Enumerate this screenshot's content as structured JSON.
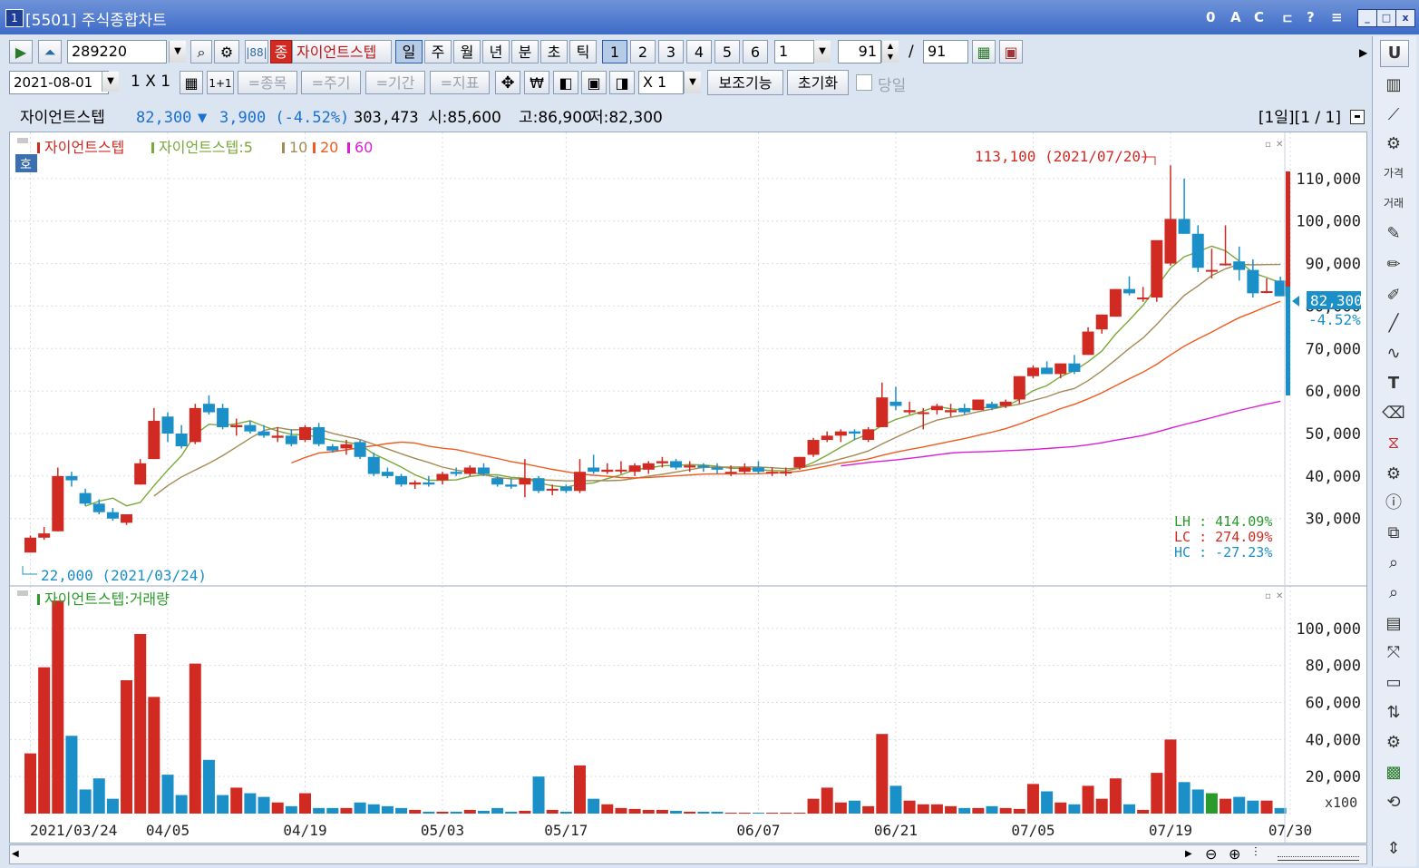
{
  "window": {
    "app_number": "1",
    "title": "[5501] 주식종합차트",
    "title_icons": [
      "0",
      "A",
      "C",
      "ㄷ",
      "?",
      "≡"
    ],
    "controls": [
      "_",
      "□",
      "x"
    ]
  },
  "toolbar1": {
    "code": "289220",
    "badge": "종",
    "stock_name": "자이언트스텝",
    "periods": [
      "일",
      "주",
      "월",
      "년",
      "분",
      "초",
      "틱"
    ],
    "numbers": [
      "1",
      "2",
      "3",
      "4",
      "5",
      "6"
    ],
    "count_value": "1",
    "range_value": "91",
    "range_sep": "/",
    "range_total": "91"
  },
  "toolbar2": {
    "date": "2021-08-01",
    "layout": "1 X 1",
    "layout_btn": "1+1",
    "tabs": [
      "=종목",
      "=주기",
      "=기간",
      "=지표"
    ],
    "multiplier": "X 1",
    "aux_button": "보조기능",
    "reset_button": "초기화",
    "today_label": "당일"
  },
  "info": {
    "name": "자이언트스텝",
    "price": "82,300",
    "arrow": "▼",
    "change": "3,900 (-4.52%)",
    "volume": "303,473",
    "open": "시:85,600",
    "high": "고:86,900",
    "low": "저:82,300",
    "period": "[1일][1 / 1]"
  },
  "price_panel": {
    "legend_name": "자이언트스텝",
    "legend_ma_label": "자이언트스텝:5",
    "legend_ma": [
      "10",
      "20",
      "60"
    ],
    "ho_badge": "호",
    "high_note": "113,100 (2021/07/20)",
    "low_note": "22,000 (2021/03/24)",
    "current_price": "82,300",
    "current_pct": "-4.52%",
    "stats": [
      "LH : 414.09%",
      "LC : 274.09%",
      "HC : -27.23%"
    ],
    "y_labels": [
      "110,000",
      "100,000",
      "90,000",
      "80,000",
      "70,000",
      "60,000",
      "50,000",
      "40,000",
      "30,000"
    ]
  },
  "volume_panel": {
    "legend": "자이언트스텝:거래량",
    "y_labels": [
      "100,000",
      "80,000",
      "60,000",
      "40,000",
      "20,000"
    ],
    "unit": "x100"
  },
  "x_labels": [
    "2021/03/24",
    "04/05",
    "04/19",
    "05/03",
    "05/17",
    "06/07",
    "06/21",
    "07/05",
    "07/19",
    "07/30"
  ],
  "colors": {
    "up": "#d12a22",
    "down": "#1a8fc8",
    "ma5": "#7aa83a",
    "ma10": "#a48a55",
    "ma20": "#f05a1e",
    "ma60": "#d91ed6"
  },
  "chart_data": {
    "type": "candlestick",
    "ohlc": [
      [
        22000,
        26000,
        22000,
        25500
      ],
      [
        25500,
        28000,
        25000,
        26500
      ],
      [
        27000,
        42000,
        27000,
        40000
      ],
      [
        40000,
        41000,
        37500,
        39000
      ],
      [
        36000,
        37000,
        33000,
        33500
      ],
      [
        33500,
        34500,
        31000,
        31500
      ],
      [
        31500,
        32500,
        29500,
        30000
      ],
      [
        29000,
        31000,
        28500,
        31000
      ],
      [
        38000,
        44000,
        38000,
        43000
      ],
      [
        44000,
        56000,
        44000,
        53000
      ],
      [
        54000,
        55000,
        48000,
        50000
      ],
      [
        50000,
        52000,
        46500,
        47000
      ],
      [
        48000,
        57000,
        47500,
        56000
      ],
      [
        57000,
        59000,
        54500,
        55000
      ],
      [
        56000,
        57000,
        51000,
        51500
      ],
      [
        51500,
        53500,
        49500,
        52000
      ],
      [
        52000,
        53000,
        50000,
        50500
      ],
      [
        50500,
        52000,
        49000,
        49500
      ],
      [
        49000,
        51500,
        48000,
        49500
      ],
      [
        49500,
        51000,
        47000,
        47500
      ],
      [
        48500,
        52000,
        48000,
        51500
      ],
      [
        51500,
        52500,
        47000,
        47500
      ],
      [
        47000,
        47500,
        45500,
        46000
      ],
      [
        46500,
        48500,
        45000,
        47500
      ],
      [
        48000,
        48500,
        44000,
        44500
      ],
      [
        44500,
        45500,
        40000,
        40500
      ],
      [
        41000,
        42000,
        39500,
        40000
      ],
      [
        40000,
        40500,
        37500,
        38000
      ],
      [
        38000,
        39000,
        37000,
        38500
      ],
      [
        38500,
        40000,
        37500,
        38000
      ],
      [
        39000,
        41000,
        38000,
        40500
      ],
      [
        41000,
        42000,
        40000,
        40500
      ],
      [
        40500,
        42500,
        40000,
        42000
      ],
      [
        42000,
        43000,
        40000,
        40500
      ],
      [
        39500,
        40000,
        37500,
        38000
      ],
      [
        38000,
        39500,
        37000,
        37500
      ],
      [
        38000,
        44000,
        35000,
        39500
      ],
      [
        39500,
        40000,
        36000,
        36500
      ],
      [
        37000,
        38000,
        35500,
        37000
      ],
      [
        37500,
        38000,
        36000,
        36500
      ],
      [
        36500,
        44000,
        36000,
        41000
      ],
      [
        42000,
        45000,
        40500,
        41000
      ],
      [
        41000,
        43000,
        40500,
        41500
      ],
      [
        41500,
        43500,
        40500,
        41500
      ],
      [
        41000,
        43000,
        40000,
        42500
      ],
      [
        41500,
        43500,
        40500,
        43000
      ],
      [
        43000,
        44500,
        42000,
        43500
      ],
      [
        43500,
        44000,
        41500,
        42000
      ],
      [
        42000,
        43500,
        41000,
        42500
      ],
      [
        42500,
        43000,
        41000,
        42000
      ],
      [
        42000,
        43000,
        40500,
        41500
      ],
      [
        41000,
        42500,
        40000,
        41000
      ],
      [
        41000,
        43000,
        40500,
        42000
      ],
      [
        42000,
        43500,
        40500,
        41000
      ],
      [
        41000,
        42000,
        40000,
        41000
      ],
      [
        41000,
        42000,
        40000,
        41000
      ],
      [
        42000,
        44500,
        41500,
        44500
      ],
      [
        45000,
        49000,
        44500,
        48500
      ],
      [
        48500,
        50500,
        48000,
        49500
      ],
      [
        49500,
        51000,
        48000,
        50500
      ],
      [
        50500,
        51000,
        48500,
        50000
      ],
      [
        48500,
        51500,
        48000,
        51000
      ],
      [
        51500,
        62000,
        51500,
        58500
      ],
      [
        57500,
        61000,
        55500,
        56500
      ],
      [
        55000,
        57500,
        54500,
        55500
      ],
      [
        55000,
        56000,
        51000,
        55000
      ],
      [
        55500,
        57000,
        54500,
        56500
      ],
      [
        55000,
        57000,
        54000,
        55500
      ],
      [
        56000,
        57000,
        54500,
        55000
      ],
      [
        55500,
        58000,
        55500,
        58000
      ],
      [
        57000,
        57500,
        55500,
        56000
      ],
      [
        56500,
        58000,
        56000,
        57500
      ],
      [
        58000,
        63500,
        57000,
        63500
      ],
      [
        63500,
        66000,
        63000,
        65500
      ],
      [
        65500,
        67000,
        64000,
        64000
      ],
      [
        64000,
        66500,
        63000,
        66500
      ],
      [
        66500,
        68500,
        64000,
        64500
      ],
      [
        68500,
        75000,
        68500,
        74000
      ],
      [
        74500,
        78000,
        73500,
        78000
      ],
      [
        77500,
        84000,
        77500,
        84000
      ],
      [
        84000,
        87000,
        82500,
        83000
      ],
      [
        82000,
        84500,
        81000,
        82000
      ],
      [
        82000,
        94000,
        81000,
        95500
      ],
      [
        90000,
        113100,
        89500,
        100500
      ],
      [
        100500,
        110000,
        97000,
        97000
      ],
      [
        97000,
        99000,
        88000,
        89000
      ],
      [
        88500,
        93500,
        86500,
        88500
      ],
      [
        90000,
        99000,
        89500,
        90000
      ],
      [
        90500,
        94000,
        86000,
        88500
      ],
      [
        88500,
        91000,
        82000,
        83000
      ],
      [
        83500,
        86500,
        83000,
        83500
      ],
      [
        86000,
        86900,
        82300,
        82300
      ]
    ],
    "volume": [
      32500,
      79000,
      115000,
      42000,
      13000,
      19000,
      8000,
      72000,
      97000,
      63000,
      21000,
      10000,
      81000,
      29000,
      10000,
      14000,
      11000,
      9000,
      6000,
      4000,
      11000,
      3000,
      3000,
      3000,
      6000,
      5000,
      4000,
      3000,
      2000,
      1000,
      1000,
      1000,
      2000,
      1500,
      3000,
      1000,
      1500,
      20000,
      2000,
      1000,
      26000,
      8000,
      5000,
      3000,
      2500,
      2000,
      2000,
      1500,
      1000,
      1000,
      1000,
      500,
      500,
      500,
      500,
      500,
      500,
      8000,
      14000,
      6000,
      7000,
      4000,
      43000,
      15000,
      7000,
      5000,
      5000,
      4000,
      3000,
      3000,
      4000,
      3000,
      2500,
      16000,
      12000,
      6000,
      5000,
      15000,
      8000,
      19000,
      5000,
      2000,
      22000,
      40000,
      17000,
      13000,
      11000,
      8000,
      9000,
      7000,
      7000,
      3000
    ],
    "x_range": [
      "2021/03/24",
      "2021/07/30"
    ],
    "y_range_price": [
      15000,
      120000
    ],
    "y_range_volume": [
      0,
      120000
    ],
    "moving_averages": [
      5,
      10,
      20,
      60
    ]
  }
}
